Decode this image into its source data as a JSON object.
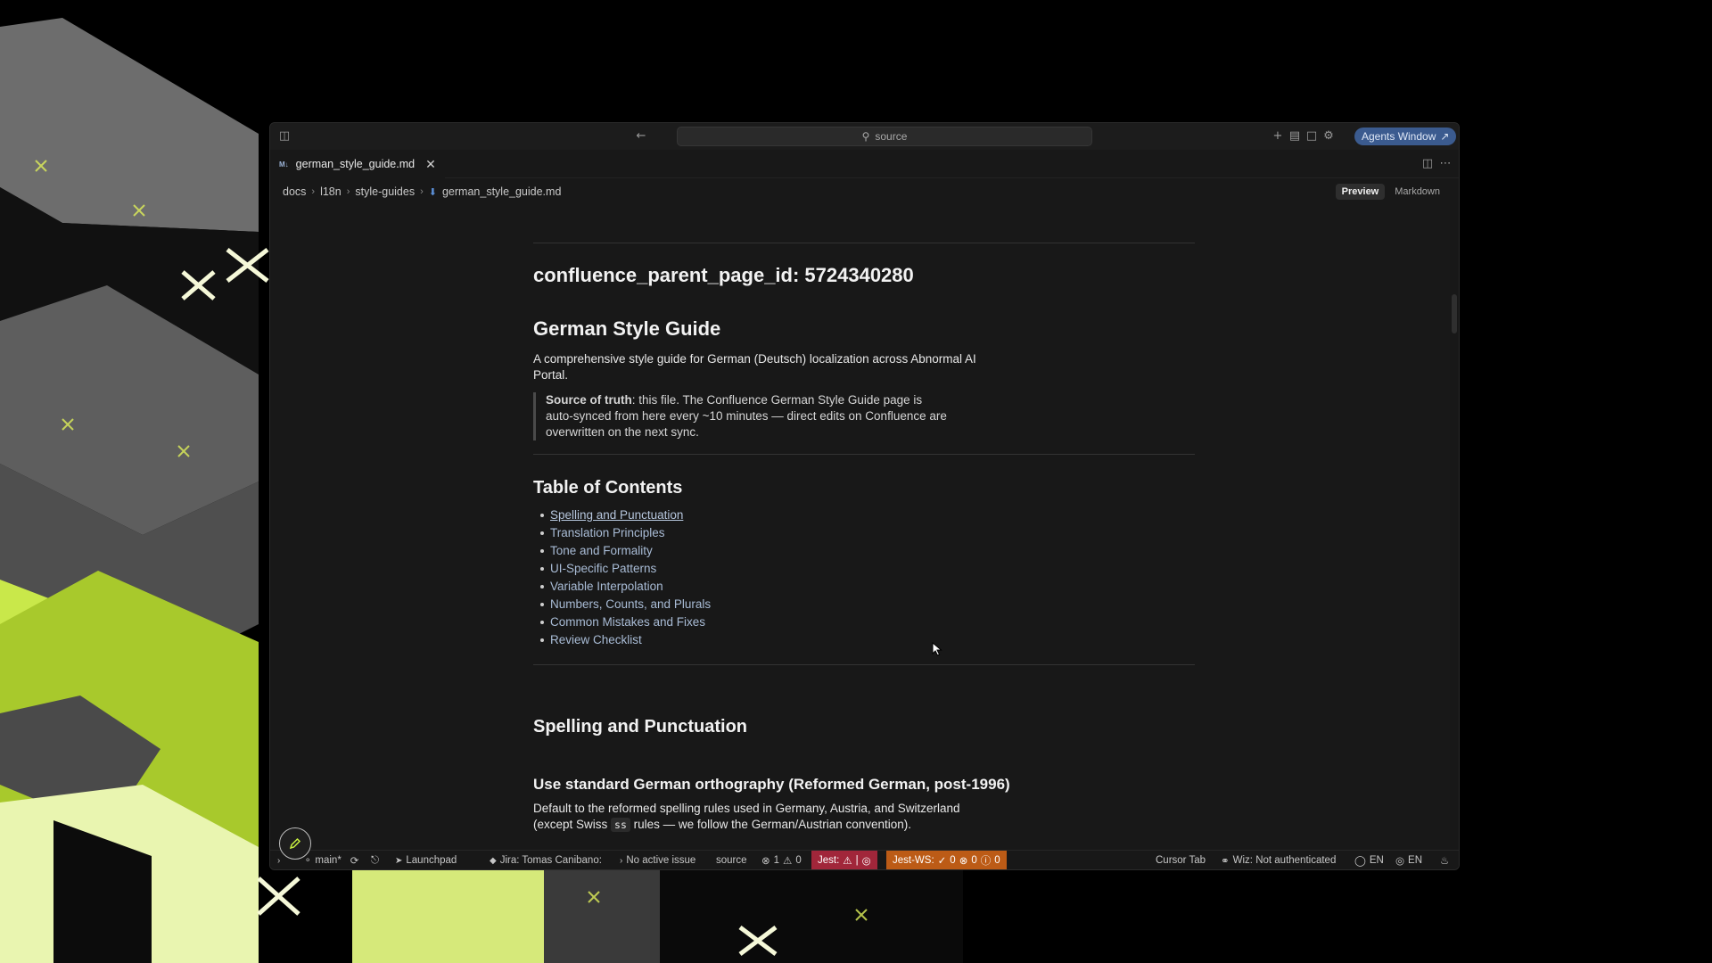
{
  "window": {
    "search_placeholder": "source",
    "agents_button": "Agents Window",
    "agents_icon": "arrow-up-right-icon"
  },
  "tab": {
    "file_badge": "M↓",
    "label": "german_style_guide.md"
  },
  "breadcrumb": [
    "docs",
    "l18n",
    "style-guides",
    "german_style_guide.md"
  ],
  "view_modes": {
    "preview": "Preview",
    "markdown": "Markdown",
    "active": "Preview"
  },
  "document": {
    "frontmatter_heading": "confluence_parent_page_id: 5724340280",
    "title": "German Style Guide",
    "intro": "A comprehensive style guide for German (Deutsch) localization across Abnormal AI Portal.",
    "callout_bold": "Source of truth",
    "callout_text": ": this file. The Confluence German Style Guide page is auto-synced from here every ~10 minutes — direct edits on Confluence are overwritten on the next sync.",
    "toc_heading": "Table of Contents",
    "toc": [
      "Spelling and Punctuation",
      "Translation Principles",
      "Tone and Formality",
      "UI-Specific Patterns",
      "Variable Interpolation",
      "Numbers, Counts, and Plurals",
      "Common Mistakes and Fixes",
      "Review Checklist"
    ],
    "section_heading": "Spelling and Punctuation",
    "subsection_heading": "Use standard German orthography (Reformed German, post-1996)",
    "body_1": "Default to the reformed spelling rules used in Germany, Austria, and Switzerland",
    "body_2a": "(except Swiss ",
    "body_code": "ss",
    "body_2b": " rules — we follow the German/Austrian convention)."
  },
  "statusbar": {
    "branch": "main*",
    "launchpad": "Launchpad",
    "jira": "Jira: Tomas Canibano:",
    "issue": "No active issue",
    "source": "source",
    "errors": "1",
    "warnings": "0",
    "jest": "Jest:",
    "jest_sep": "|",
    "jest_ws": "Jest-WS:",
    "jest_ws_counts": [
      "0",
      "0",
      "0"
    ],
    "cursor_tab": "Cursor Tab",
    "wiz": "Wiz: Not authenticated",
    "lang1": "EN",
    "lang2": "EN"
  },
  "colors": {
    "accent": "#3b5b8f",
    "jest_bg": "#a1263a",
    "jest_ws_bg": "#bc5b16",
    "link": "#a9bcd6"
  }
}
